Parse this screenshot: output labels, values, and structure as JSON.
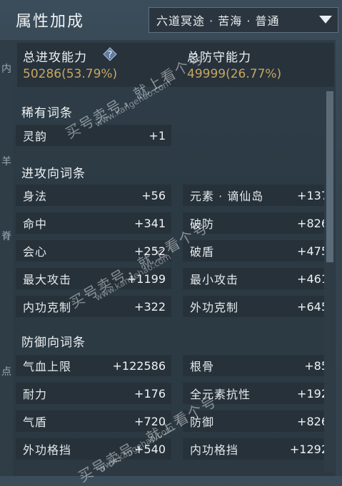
{
  "header": {
    "title": "属性加成",
    "server_select": "六道冥途 · 苦海 · 普通"
  },
  "summary": {
    "attack_label": "总进攻能力",
    "attack_value": "50286(53.79%)",
    "defense_label": "总防守能力",
    "defense_value": "49999(26.77%)"
  },
  "sections": {
    "rare": "稀有词条",
    "attack": "进攻向词条",
    "defense": "防御向词条"
  },
  "rare_items": [
    {
      "name": "灵韵",
      "value": "+1"
    }
  ],
  "attack_items": [
    {
      "name": "身法",
      "value": "+56"
    },
    {
      "name": "元素 · 谪仙岛",
      "value": "+137"
    },
    {
      "name": "命中",
      "value": "+341"
    },
    {
      "name": "破防",
      "value": "+826"
    },
    {
      "name": "会心",
      "value": "+252"
    },
    {
      "name": "破盾",
      "value": "+475"
    },
    {
      "name": "最大攻击",
      "value": "+1199"
    },
    {
      "name": "最小攻击",
      "value": "+461"
    },
    {
      "name": "内功克制",
      "value": "+322"
    },
    {
      "name": "外功克制",
      "value": "+645"
    }
  ],
  "defense_items": [
    {
      "name": "气血上限",
      "value": "+122586"
    },
    {
      "name": "根骨",
      "value": "+85"
    },
    {
      "name": "耐力",
      "value": "+176"
    },
    {
      "name": "全元素抗性",
      "value": "+192"
    },
    {
      "name": "气盾",
      "value": "+720"
    },
    {
      "name": "防御",
      "value": "+826"
    },
    {
      "name": "外功格挡",
      "value": "+540"
    },
    {
      "name": "内功格挡",
      "value": "+1292"
    }
  ],
  "watermark": {
    "text_big": "买号卖号，就上看个号",
    "text_url": "www.kangehao.com",
    "text_small": "看个号"
  },
  "colors": {
    "value_gold": "#c8a660",
    "cell_bg": "#26313a"
  }
}
